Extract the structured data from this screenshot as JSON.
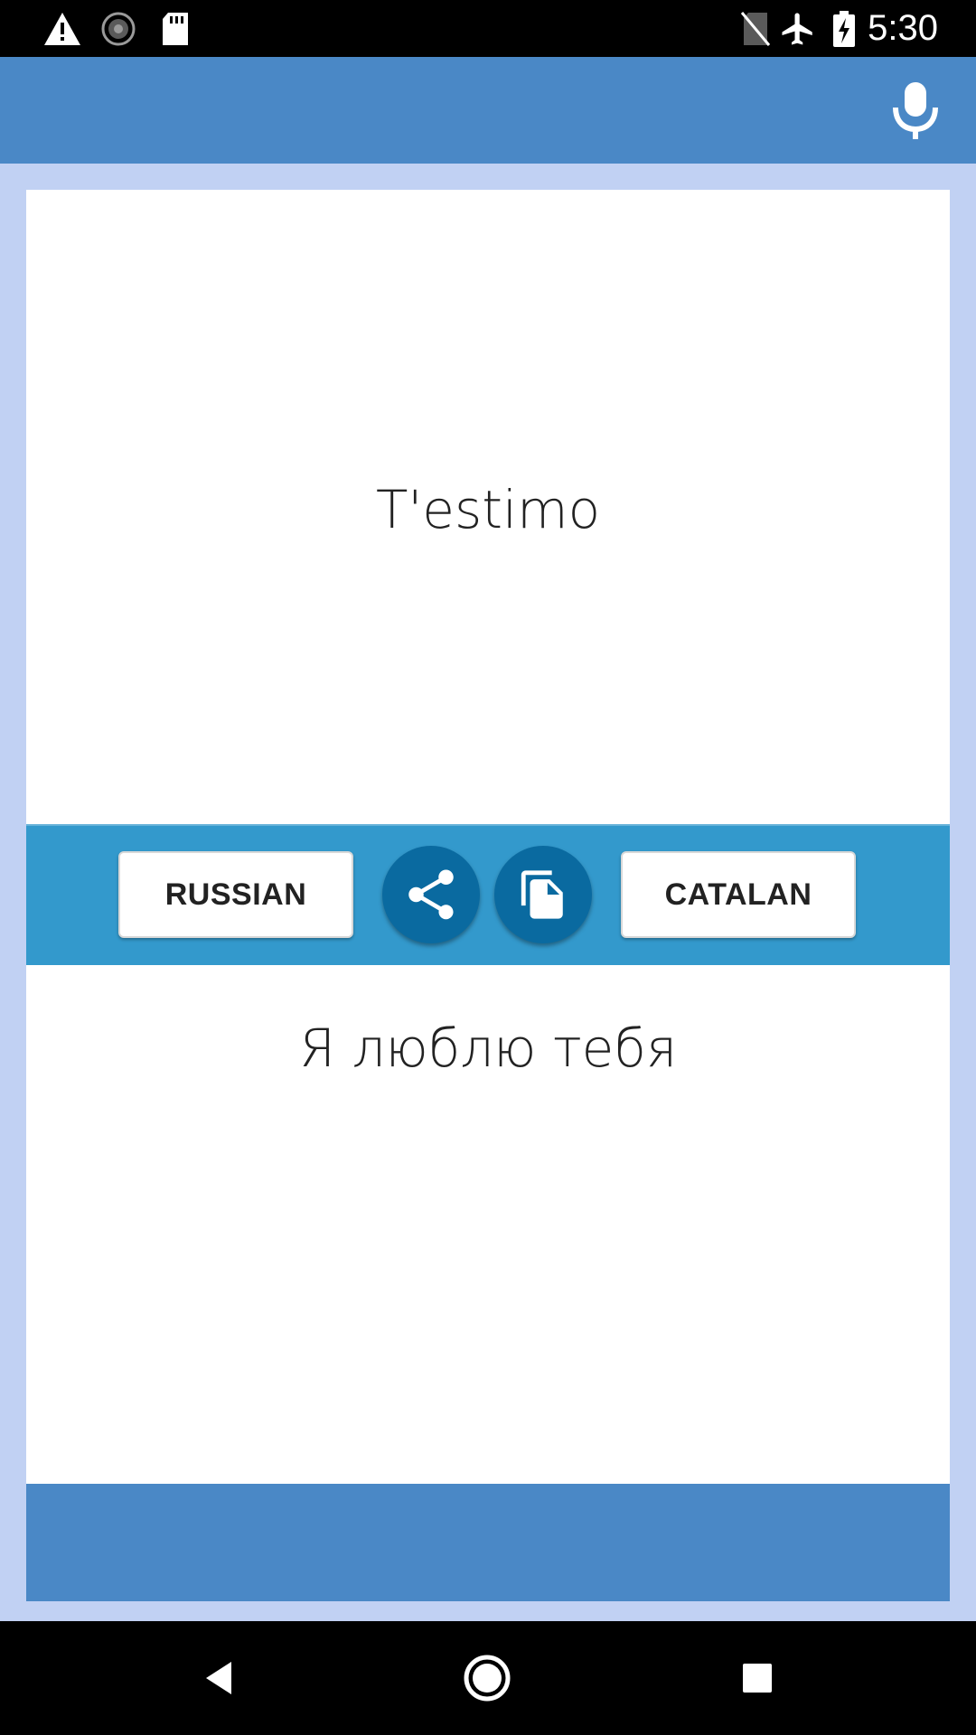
{
  "status_bar": {
    "time": "5:30",
    "icons": [
      "warning-icon",
      "sync-icon",
      "sd-card-icon",
      "no-sim-icon",
      "airplane-icon",
      "battery-charging-icon"
    ]
  },
  "app_bar": {
    "mic_icon": "mic-icon"
  },
  "source": {
    "text": "T'estimo"
  },
  "target": {
    "text": "Я люблю тебя"
  },
  "toolbar": {
    "left_language": "RUSSIAN",
    "right_language": "CATALAN",
    "share_icon": "share-icon",
    "copy_icon": "copy-icon"
  },
  "nav_bar": {
    "icons": [
      "back-icon",
      "home-icon",
      "recents-icon"
    ]
  },
  "colors": {
    "app_bar": "#4a88c6",
    "background": "#c1d1f3",
    "toolbar": "#3399cc",
    "round_button": "#0a6aa0"
  }
}
